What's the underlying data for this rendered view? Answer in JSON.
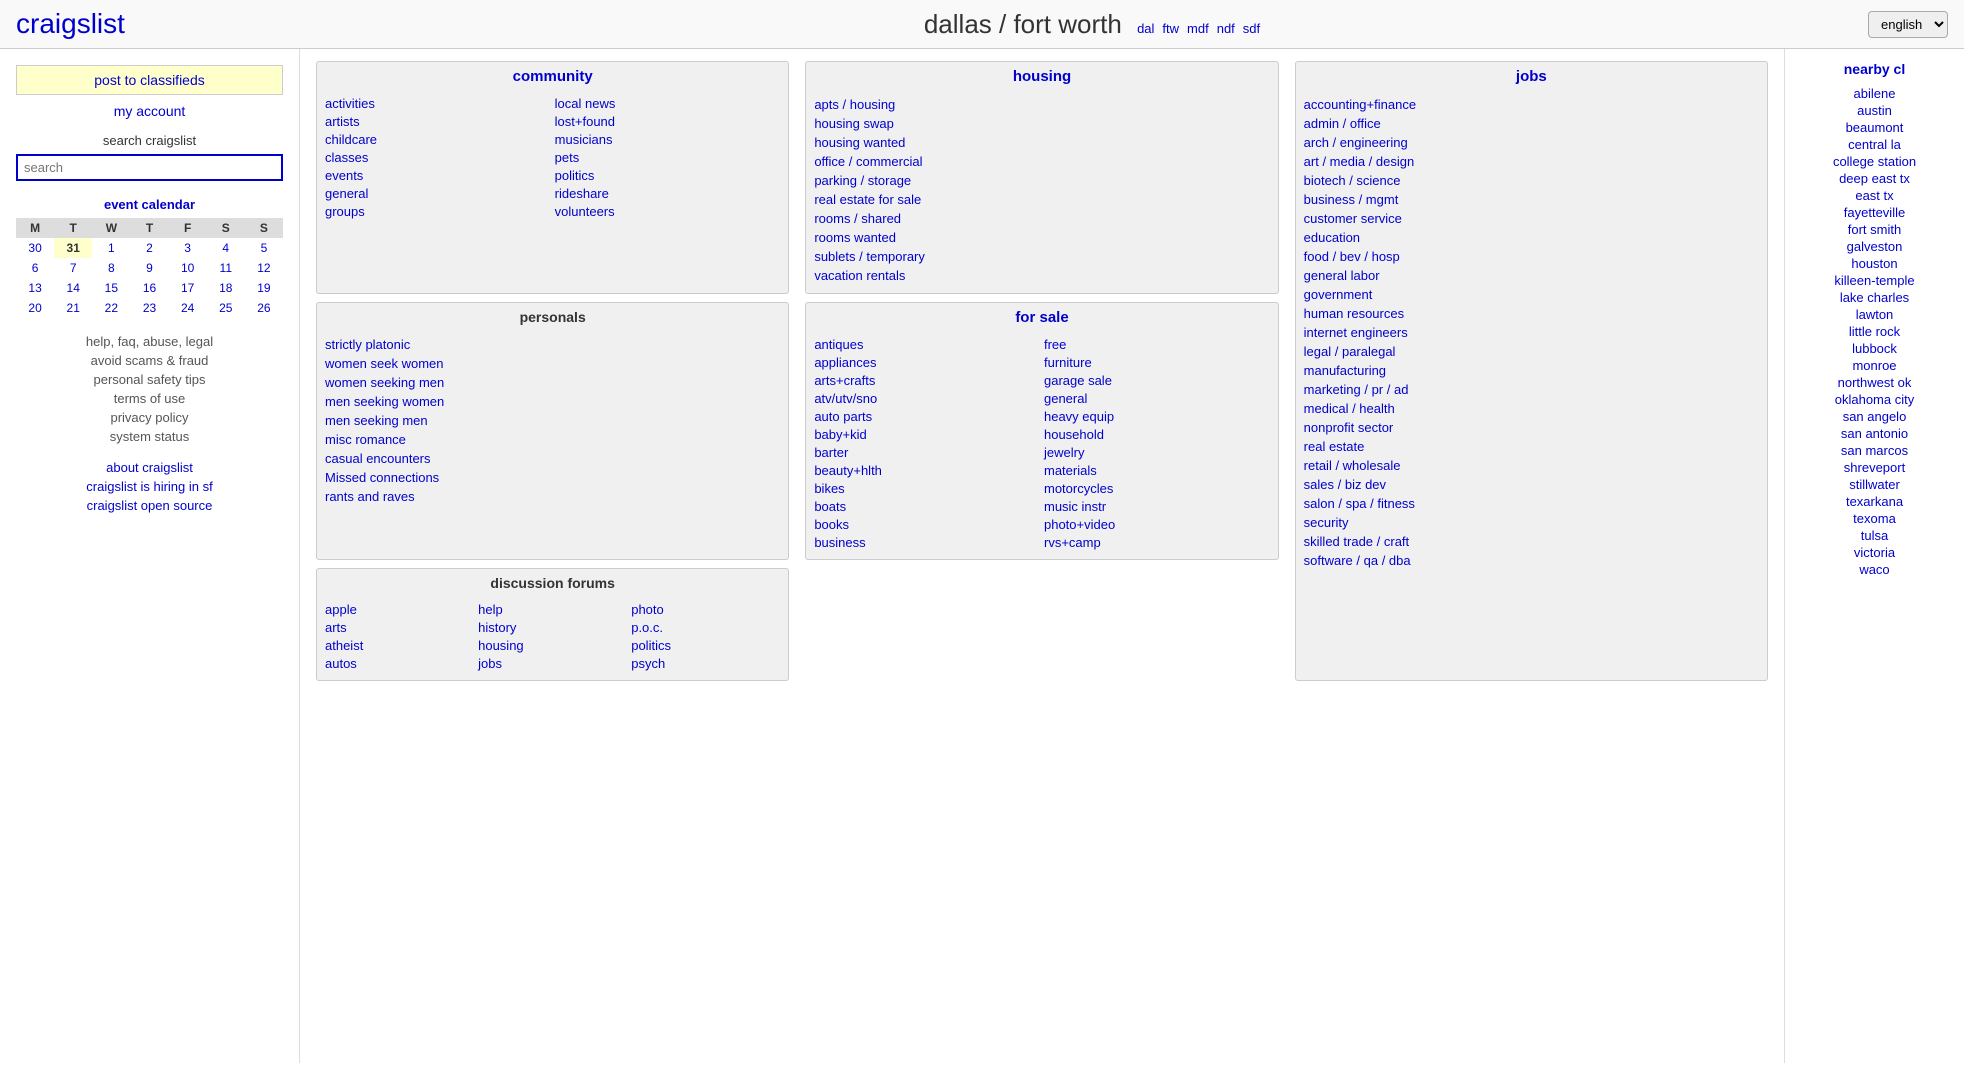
{
  "header": {
    "logo": "craigslist",
    "city": "dallas / fort worth",
    "city_links": [
      "dal",
      "ftw",
      "mdf",
      "ndf",
      "sdf"
    ],
    "language": "english"
  },
  "sidebar": {
    "post_classifieds": "post to classifieds",
    "my_account": "my account",
    "search_label": "search craigslist",
    "search_placeholder": "search",
    "calendar_title": "event calendar",
    "calendar_days": [
      "M",
      "T",
      "W",
      "T",
      "F",
      "S",
      "S"
    ],
    "calendar_rows": [
      [
        "30",
        "31",
        "1",
        "2",
        "3",
        "4",
        "5"
      ],
      [
        "6",
        "7",
        "8",
        "9",
        "10",
        "11",
        "12"
      ],
      [
        "13",
        "14",
        "15",
        "16",
        "17",
        "18",
        "19"
      ],
      [
        "20",
        "21",
        "22",
        "23",
        "24",
        "25",
        "26"
      ]
    ],
    "calendar_today": "31",
    "help_links": [
      "help, faq, abuse, legal",
      "avoid scams & fraud",
      "personal safety tips",
      "terms of use",
      "privacy policy",
      "system status"
    ],
    "about_links": [
      "about craigslist",
      "craigslist is hiring in sf",
      "craigslist open source"
    ]
  },
  "community": {
    "title": "community",
    "col1": [
      "activities",
      "artists",
      "childcare",
      "classes",
      "events",
      "general",
      "groups"
    ],
    "col2": [
      "local news",
      "lost+found",
      "musicians",
      "pets",
      "politics",
      "rideshare",
      "volunteers"
    ]
  },
  "personals": {
    "title": "personals",
    "items": [
      "strictly platonic",
      "women seek women",
      "women seeking men",
      "men seeking women",
      "men seeking men",
      "misc romance",
      "casual encounters",
      "Missed connections",
      "rants and raves"
    ]
  },
  "discussion_forums": {
    "title": "discussion forums",
    "col1": [
      "apple",
      "arts",
      "atheist",
      "autos"
    ],
    "col2": [
      "help",
      "history",
      "housing",
      "jobs"
    ],
    "col3": [
      "photo",
      "p.o.c.",
      "politics",
      "psych"
    ]
  },
  "housing": {
    "title": "housing",
    "items": [
      "apts / housing",
      "housing swap",
      "housing wanted",
      "office / commercial",
      "parking / storage",
      "real estate for sale",
      "rooms / shared",
      "rooms wanted",
      "sublets / temporary",
      "vacation rentals"
    ]
  },
  "for_sale": {
    "title": "for sale",
    "col1": [
      "antiques",
      "appliances",
      "arts+crafts",
      "atv/utv/sno",
      "auto parts",
      "baby+kid",
      "barter",
      "beauty+hlth",
      "bikes",
      "boats",
      "books",
      "business"
    ],
    "col2": [
      "free",
      "furniture",
      "garage sale",
      "general",
      "heavy equip",
      "household",
      "jewelry",
      "materials",
      "motorcycles",
      "music instr",
      "photo+video",
      "rvs+camp"
    ]
  },
  "jobs": {
    "title": "jobs",
    "items": [
      "accounting+finance",
      "admin / office",
      "arch / engineering",
      "art / media / design",
      "biotech / science",
      "business / mgmt",
      "customer service",
      "education",
      "food / bev / hosp",
      "general labor",
      "government",
      "human resources",
      "internet engineers",
      "legal / paralegal",
      "manufacturing",
      "marketing / pr / ad",
      "medical / health",
      "nonprofit sector",
      "real estate",
      "retail / wholesale",
      "sales / biz dev",
      "salon / spa / fitness",
      "security",
      "skilled trade / craft",
      "software / qa / dba"
    ]
  },
  "nearby_cl": {
    "title": "nearby cl",
    "cities": [
      "abilene",
      "austin",
      "beaumont",
      "central la",
      "college station",
      "deep east tx",
      "east tx",
      "fayetteville",
      "fort smith",
      "galveston",
      "houston",
      "killeen-temple",
      "lake charles",
      "lawton",
      "little rock",
      "lubbock",
      "monroe",
      "northwest ok",
      "oklahoma city",
      "san angelo",
      "san antonio",
      "san marcos",
      "shreveport",
      "stillwater",
      "texarkana",
      "texoma",
      "tulsa",
      "victoria",
      "waco"
    ]
  }
}
